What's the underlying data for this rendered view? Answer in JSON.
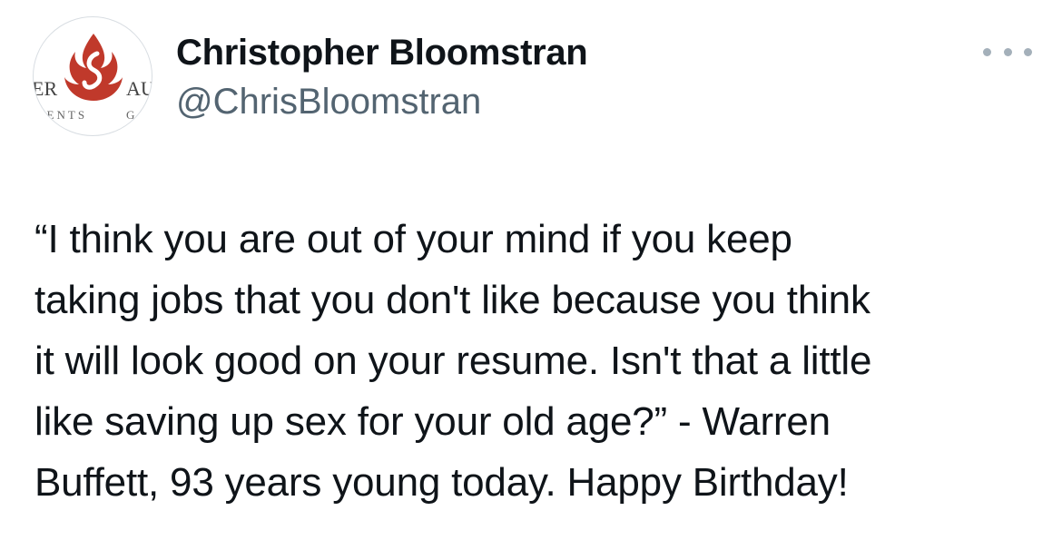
{
  "author": {
    "name": "Christopher Bloomstran",
    "handle": "@ChrisBloomstran",
    "avatar_icon": "semper-augustus-logo",
    "avatar_text_left": "ER",
    "avatar_text_right": "AU",
    "avatar_subtext_left": "MENTS",
    "avatar_subtext_right": "G",
    "brand_color": "#c0392b"
  },
  "more_icon": "ellipsis-icon",
  "tweet": {
    "text": "“I think you are out of your mind if you keep\ntaking jobs that you don't like because you think\nit will look good on your resume. Isn't that a little\nlike saving up sex for your old age?” - Warren\nBuffett, 93 years young today. Happy Birthday!"
  }
}
